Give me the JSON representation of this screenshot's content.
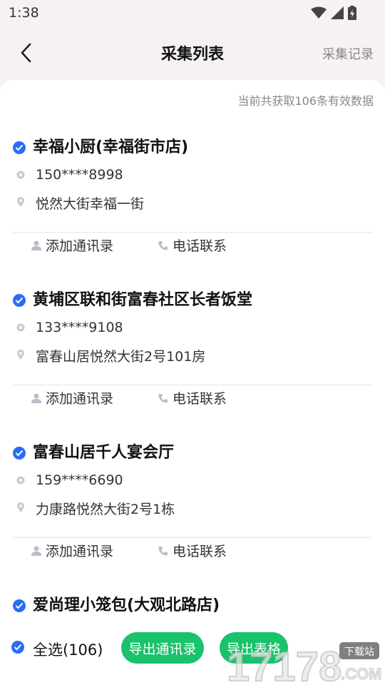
{
  "status": {
    "time": "1:38"
  },
  "nav": {
    "title": "采集列表",
    "record": "采集记录"
  },
  "summary": "当前共获取106条有效数据",
  "items": [
    {
      "name": "幸福小厨(幸福街市店)",
      "phone": "150****8998",
      "address": "悦然大街幸福一街",
      "add_label": "添加通讯录",
      "call_label": "电话联系"
    },
    {
      "name": "黄埔区联和街富春社区长者饭堂",
      "phone": "133****9108",
      "address": "富春山居悦然大街2号101房",
      "add_label": "添加通讯录",
      "call_label": "电话联系"
    },
    {
      "name": "富春山居千人宴会厅",
      "phone": "159****6690",
      "address": "力康路悦然大街2号1栋",
      "add_label": "添加通讯录",
      "call_label": "电话联系"
    },
    {
      "name": "爱尚理小笼包(大观北路店)"
    }
  ],
  "bottom": {
    "select_all": "全选(106)",
    "export_contacts": "导出通讯录",
    "export_sheet": "导出表格"
  },
  "watermark": {
    "text": "17178.COM",
    "badge": "下载站"
  },
  "colors": {
    "accent_blue": "#2a6df4",
    "button_green": "#19c26b"
  }
}
